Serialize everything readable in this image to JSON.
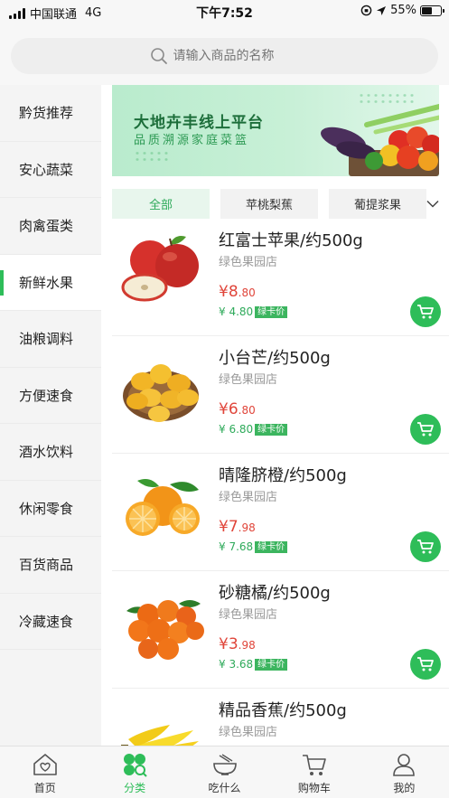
{
  "status_bar": {
    "carrier": "中国联通",
    "network": "4G",
    "time": "下午7:52",
    "battery": "55%",
    "battery_level": 0.55
  },
  "search": {
    "placeholder": "请输入商品的名称"
  },
  "sidebar": {
    "items": [
      {
        "label": "黔货推荐"
      },
      {
        "label": "安心蔬菜"
      },
      {
        "label": "肉禽蛋类"
      },
      {
        "label": "新鲜水果",
        "active": true
      },
      {
        "label": "油粮调料"
      },
      {
        "label": "方便速食"
      },
      {
        "label": "酒水饮料"
      },
      {
        "label": "休闲零食"
      },
      {
        "label": "百货商品"
      },
      {
        "label": "冷藏速食"
      }
    ]
  },
  "banner": {
    "title": "大地卉丰线上平台",
    "subtitle": "品质溯源家庭菜篮"
  },
  "tabs": [
    {
      "label": "全部",
      "active": true
    },
    {
      "label": "苹桃梨蕉"
    },
    {
      "label": "葡提浆果"
    }
  ],
  "products": [
    {
      "name": "红富士苹果/约500g",
      "store": "绿色果园店",
      "currency": "¥",
      "price_int": "8",
      "price_dec": ".80",
      "card_price": "¥ 4.80",
      "card_badge": "绿卡价",
      "image": "apple"
    },
    {
      "name": "小台芒/约500g",
      "store": "绿色果园店",
      "currency": "¥",
      "price_int": "6",
      "price_dec": ".80",
      "card_price": "¥ 6.80",
      "card_badge": "绿卡价",
      "image": "mango"
    },
    {
      "name": "晴隆脐橙/约500g",
      "store": "绿色果园店",
      "currency": "¥",
      "price_int": "7",
      "price_dec": ".98",
      "card_price": "¥ 7.68",
      "card_badge": "绿卡价",
      "image": "orange"
    },
    {
      "name": "砂糖橘/约500g",
      "store": "绿色果园店",
      "currency": "¥",
      "price_int": "3",
      "price_dec": ".98",
      "card_price": "¥ 3.68",
      "card_badge": "绿卡价",
      "image": "tangerine"
    },
    {
      "name": "精品香蕉/约500g",
      "store": "绿色果园店",
      "image": "banana"
    }
  ],
  "tabbar": [
    {
      "label": "首页",
      "icon": "home-icon"
    },
    {
      "label": "分类",
      "icon": "category-icon",
      "active": true
    },
    {
      "label": "吃什么",
      "icon": "bowl-icon"
    },
    {
      "label": "购物车",
      "icon": "cart-icon"
    },
    {
      "label": "我的",
      "icon": "user-icon"
    }
  ],
  "colors": {
    "accent": "#2ebd59",
    "price": "#e0453a",
    "card_price": "#2eaa5a"
  }
}
